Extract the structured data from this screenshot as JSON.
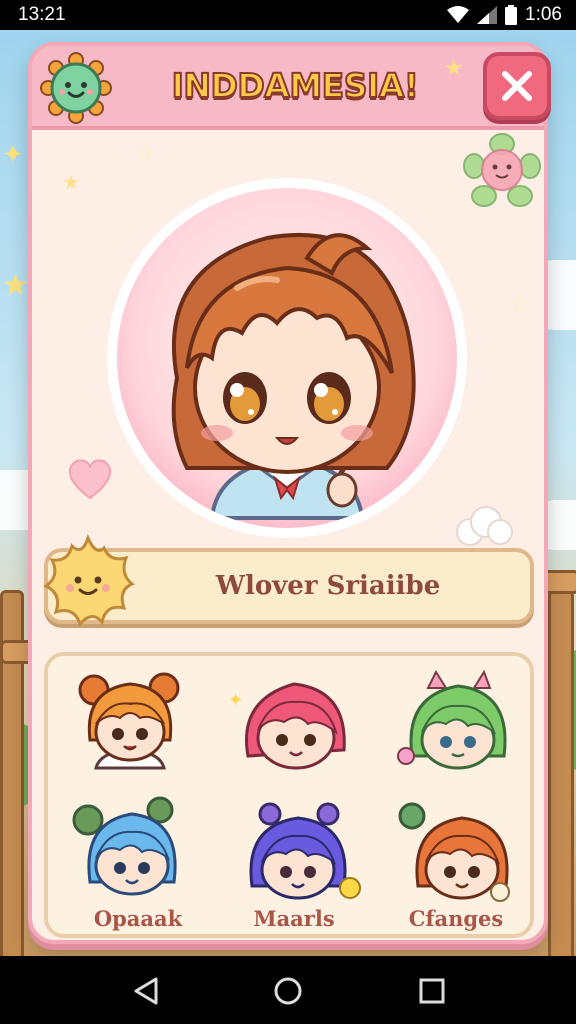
{
  "status_bar": {
    "time": "13:21",
    "right_time": "1:06",
    "icons": [
      "wifi-icon",
      "signal-icon",
      "battery-icon"
    ]
  },
  "dialog": {
    "title": "INDDAMESIA!",
    "close_icon": "close-icon",
    "header_badge_icon": "sun-face-icon",
    "portrait": "chibi-girl-orange-hair",
    "name_banner": "Wlover Sriaiibe",
    "mascot_icon": "star-face-icon"
  },
  "characters": [
    {
      "name": "orange-bun-girl",
      "label": ""
    },
    {
      "name": "pink-hair-girl",
      "label": ""
    },
    {
      "name": "green-hair-girl",
      "label": ""
    },
    {
      "name": "blue-hair-girl",
      "label": "Opaaak"
    },
    {
      "name": "purple-hair-girl",
      "label": "Maarls"
    },
    {
      "name": "orange-hair-girl",
      "label": "Cfanges"
    }
  ],
  "colors": {
    "panel_border": "#f2a8b6",
    "header": "#f7b9c6",
    "title_fill": "#ffc94a",
    "title_outline": "#8a3a2a",
    "close_button": "#f0697f",
    "banner": "#fbeccb",
    "label_text": "#a8564a"
  },
  "nav_bar": {
    "back_icon": "back-triangle-icon",
    "home_icon": "home-circle-icon",
    "recents_icon": "recents-square-icon"
  }
}
